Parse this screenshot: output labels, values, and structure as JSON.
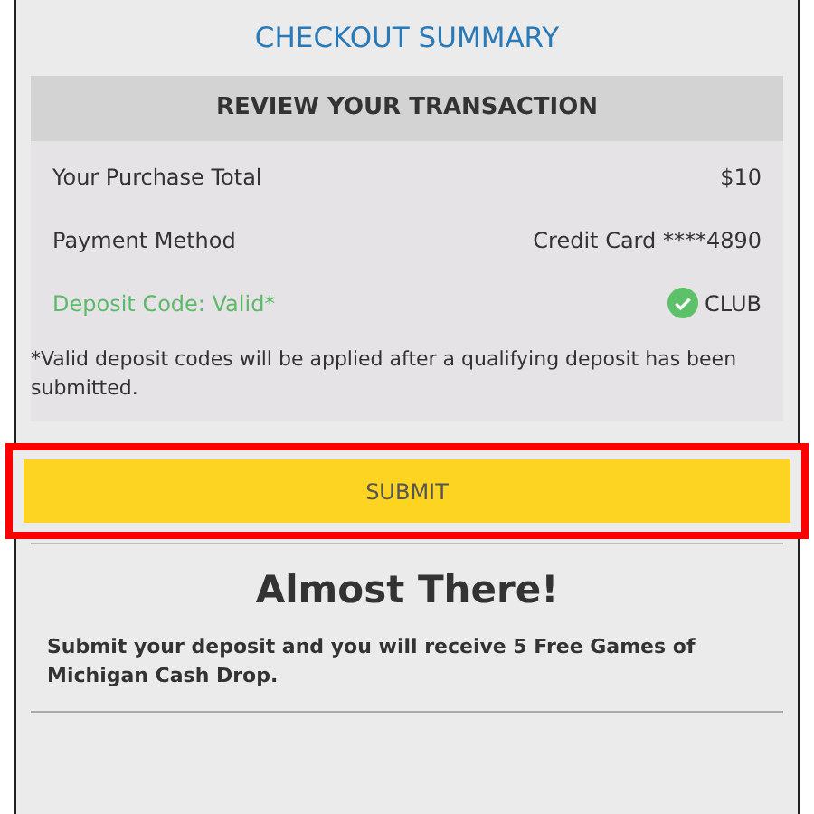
{
  "title": "CHECKOUT SUMMARY",
  "review": {
    "heading": "REVIEW YOUR TRANSACTION",
    "rows": [
      {
        "kind": "plain",
        "label": "Your Purchase Total",
        "value": "$10"
      },
      {
        "kind": "plain",
        "label": "Payment Method",
        "value": "Credit Card ****4890"
      },
      {
        "kind": "code",
        "label": "Deposit Code: Valid*",
        "value": "CLUB",
        "valid": true
      }
    ],
    "note": "*Valid deposit codes will be applied after a qualifying deposit has been submitted."
  },
  "submit": {
    "label": "SUBMIT",
    "highlighted": true
  },
  "promo": {
    "heading": "Almost There!",
    "text": "Submit your deposit and you will receive 5 Free Games of Michigan Cash Drop."
  }
}
